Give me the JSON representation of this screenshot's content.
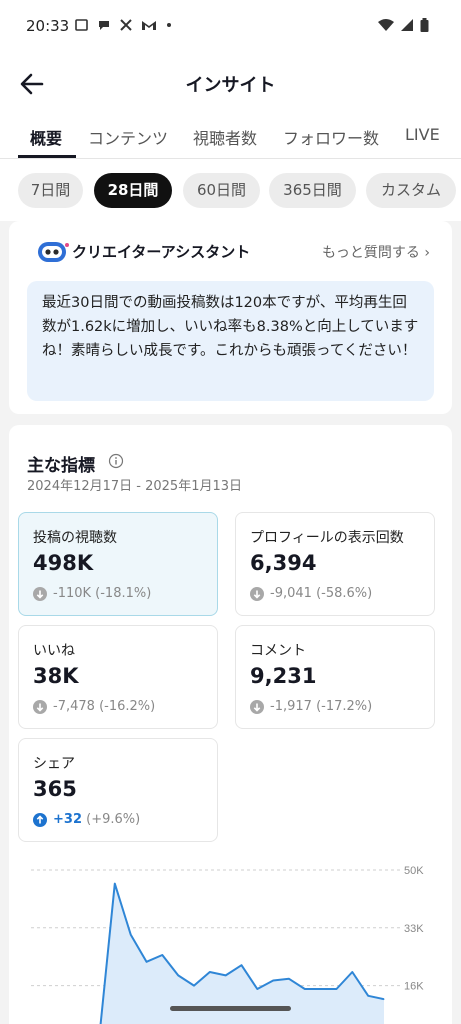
{
  "status": {
    "time": "20:33"
  },
  "header": {
    "title": "インサイト"
  },
  "tabs": [
    {
      "label": "概要",
      "active": true
    },
    {
      "label": "コンテンツ",
      "active": false
    },
    {
      "label": "視聴者数",
      "active": false
    },
    {
      "label": "フォロワー数",
      "active": false
    },
    {
      "label": "LIVE",
      "active": false
    }
  ],
  "ranges": [
    {
      "label": "7日間",
      "active": false
    },
    {
      "label": "28日間",
      "active": true
    },
    {
      "label": "60日間",
      "active": false
    },
    {
      "label": "365日間",
      "active": false
    },
    {
      "label": "カスタム",
      "active": false
    }
  ],
  "assistant": {
    "title": "クリエイターアシスタント",
    "link": "もっと質問する ›",
    "message": "最近30日間での動画投稿数は120本ですが、平均再生回数が1.62kに増加し、いいね率も8.38%と向上していますね！素晴らしい成長です。これからも頑張ってください！"
  },
  "metrics": {
    "title": "主な指標",
    "date_range": "2024年12月17日 - 2025年1月13日",
    "items": [
      {
        "label": "投稿の視聴数",
        "value": "498K",
        "delta": "-110K",
        "pct": "(-18.1%)",
        "direction": "down",
        "selected": true
      },
      {
        "label": "プロフィールの表示回数",
        "value": "6,394",
        "delta": "-9,041",
        "pct": "(-58.6%)",
        "direction": "down",
        "selected": false
      },
      {
        "label": "いいね",
        "value": "38K",
        "delta": "-7,478",
        "pct": "(-16.2%)",
        "direction": "down",
        "selected": false
      },
      {
        "label": "コメント",
        "value": "9,231",
        "delta": "-1,917",
        "pct": "(-17.2%)",
        "direction": "down",
        "selected": false
      },
      {
        "label": "シェア",
        "value": "365",
        "delta": "+32",
        "pct": "(+9.6%)",
        "direction": "up",
        "selected": false
      }
    ]
  },
  "chart_data": {
    "type": "area",
    "y_ticks": [
      "50K",
      "33K",
      "16K"
    ],
    "ylim": [
      0,
      50000
    ],
    "values": [
      0,
      46000,
      31000,
      23000,
      25000,
      19000,
      16000,
      20000,
      19000,
      22000,
      15000,
      17500,
      18000,
      15000,
      15000,
      15000,
      20000,
      13000,
      12000
    ],
    "colors": {
      "line": "#2f86d6",
      "fill": "#dcebfa"
    }
  },
  "colors": {
    "accent": "#1d73cf",
    "selected_bg": "#eef7fb",
    "assistant_bg": "#e9f2fc"
  }
}
